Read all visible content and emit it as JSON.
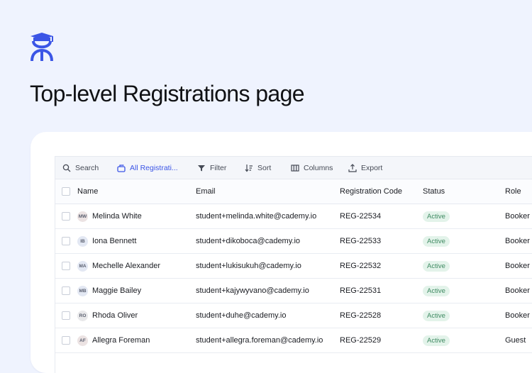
{
  "page": {
    "title": "Top-level Registrations page"
  },
  "brand": {
    "icon": "graduate-icon",
    "color": "#3b55e6"
  },
  "toolbar": {
    "search": "Search",
    "view": "All Registrati...",
    "filter": "Filter",
    "sort": "Sort",
    "columns": "Columns",
    "export": "Export"
  },
  "table": {
    "headers": {
      "name": "Name",
      "email": "Email",
      "code": "Registration Code",
      "status": "Status",
      "role": "Role"
    },
    "rows": [
      {
        "initials": "MW",
        "avatar_color": "#ece3e3",
        "name": "Melinda White",
        "email": "student+melinda.white@cademy.io",
        "code": "REG-22534",
        "status": "Active",
        "role": "Booker"
      },
      {
        "initials": "IB",
        "avatar_color": "#e3e8f3",
        "name": "Iona Bennett",
        "email": "student+dikoboca@cademy.io",
        "code": "REG-22533",
        "status": "Active",
        "role": "Booker"
      },
      {
        "initials": "MA",
        "avatar_color": "#e3e8f3",
        "name": "Mechelle Alexander",
        "email": "student+lukisukuh@cademy.io",
        "code": "REG-22532",
        "status": "Active",
        "role": "Booker"
      },
      {
        "initials": "MB",
        "avatar_color": "#e3e8f3",
        "name": "Maggie Bailey",
        "email": "student+kajywyvano@cademy.io",
        "code": "REG-22531",
        "status": "Active",
        "role": "Booker"
      },
      {
        "initials": "RO",
        "avatar_color": "#e8e8ea",
        "name": "Rhoda Oliver",
        "email": "student+duhe@cademy.io",
        "code": "REG-22528",
        "status": "Active",
        "role": "Booker"
      },
      {
        "initials": "AF",
        "avatar_color": "#ece3e3",
        "name": "Allegra Foreman",
        "email": "student+allegra.foreman@cademy.io",
        "code": "REG-22529",
        "status": "Active",
        "role": "Guest"
      }
    ]
  }
}
